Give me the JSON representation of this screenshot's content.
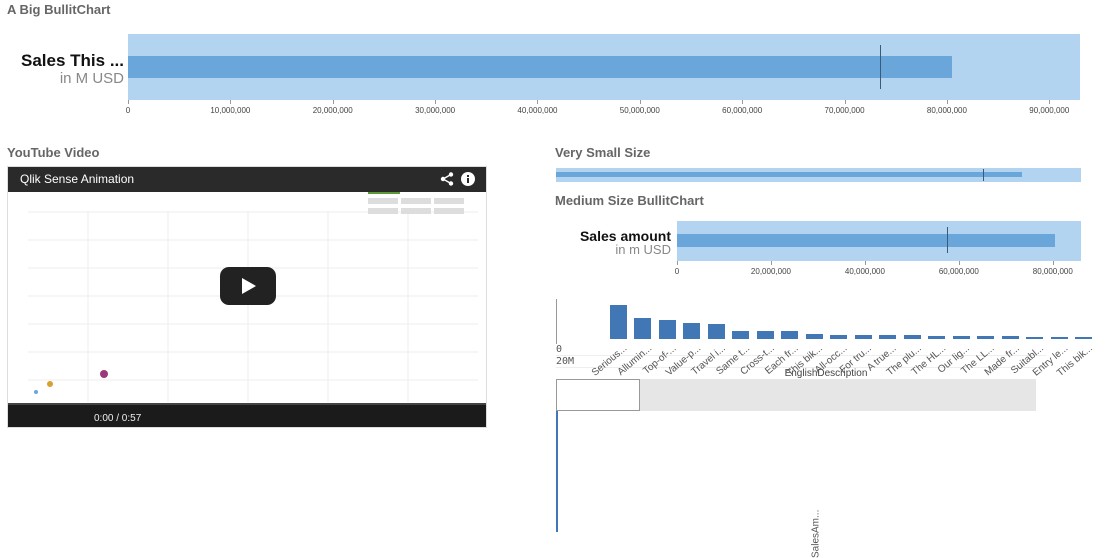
{
  "big_bullet": {
    "title": "A Big BullitChart",
    "label": "Sales This ...",
    "sublabel": "in M USD",
    "chart_data": {
      "type": "bullet",
      "value": 80500000,
      "target": 73500000,
      "range_max": 93000000,
      "axis_min": 0,
      "ticks": [
        0,
        10000000,
        20000000,
        30000000,
        40000000,
        50000000,
        60000000,
        70000000,
        80000000,
        90000000
      ],
      "tick_labels": [
        "0",
        "10,000,000",
        "20,000,000",
        "30,000,000",
        "40,000,000",
        "50,000,000",
        "60,000,000",
        "70,000,000",
        "80,000,000",
        "90,000,000"
      ],
      "colors": {
        "band": "#b3d4f0",
        "bar": "#6aa6d9",
        "marker": "#3a5a7a"
      }
    }
  },
  "youtube": {
    "title": "YouTube Video",
    "video_title": "Qlik Sense Animation",
    "time": "0:00 / 0:57",
    "share_icon": "share-icon",
    "info_icon": "info-icon",
    "play_icon": "play-icon"
  },
  "small_bullet": {
    "title": "Very Small Size",
    "chart_data": {
      "type": "bullet",
      "value": 71000000,
      "target": 65000000,
      "range_max": 80000000,
      "axis_min": 0
    }
  },
  "medium_bullet": {
    "title": "Medium Size BullitChart",
    "label": "Sales amount",
    "sublabel": "in m USD",
    "chart_data": {
      "type": "bullet",
      "value": 80500000,
      "target": 57500000,
      "range_max": 86000000,
      "axis_min": 0,
      "ticks": [
        0,
        20000000,
        40000000,
        60000000,
        80000000
      ],
      "tick_labels": [
        "0",
        "20,000,000",
        "40,000,000",
        "60,000,000",
        "80,000,000"
      ]
    }
  },
  "bar_chart": {
    "chart_data": {
      "type": "bar",
      "xlabel": "EnglishDescription",
      "ylabel": "SalesAm...",
      "ylim": [
        0,
        22000000
      ],
      "y_ticks": [
        0,
        20000000
      ],
      "y_tick_labels": [
        "0",
        "20M"
      ],
      "categories": [
        "Serious...",
        "Allumin...",
        "Top-of-...",
        "Value-p...",
        "Travel i...",
        "Same t...",
        "Cross-t...",
        "Each fr...",
        "This bik...",
        "All-occ...",
        "For tru...",
        "A true...",
        "The plu...",
        "The HL...",
        "Our lig...",
        "The LL...",
        "Made fr...",
        "Suitabl...",
        "Entry le...",
        "This bik..."
      ],
      "values": [
        16500000,
        10500000,
        9500000,
        8000000,
        7500000,
        4000000,
        4000000,
        3800000,
        2500000,
        2200000,
        2000000,
        1900000,
        1800000,
        1700000,
        1500000,
        1400000,
        1300000,
        1200000,
        1100000,
        1000000
      ],
      "colors": {
        "bar": "#4177b4"
      }
    }
  }
}
